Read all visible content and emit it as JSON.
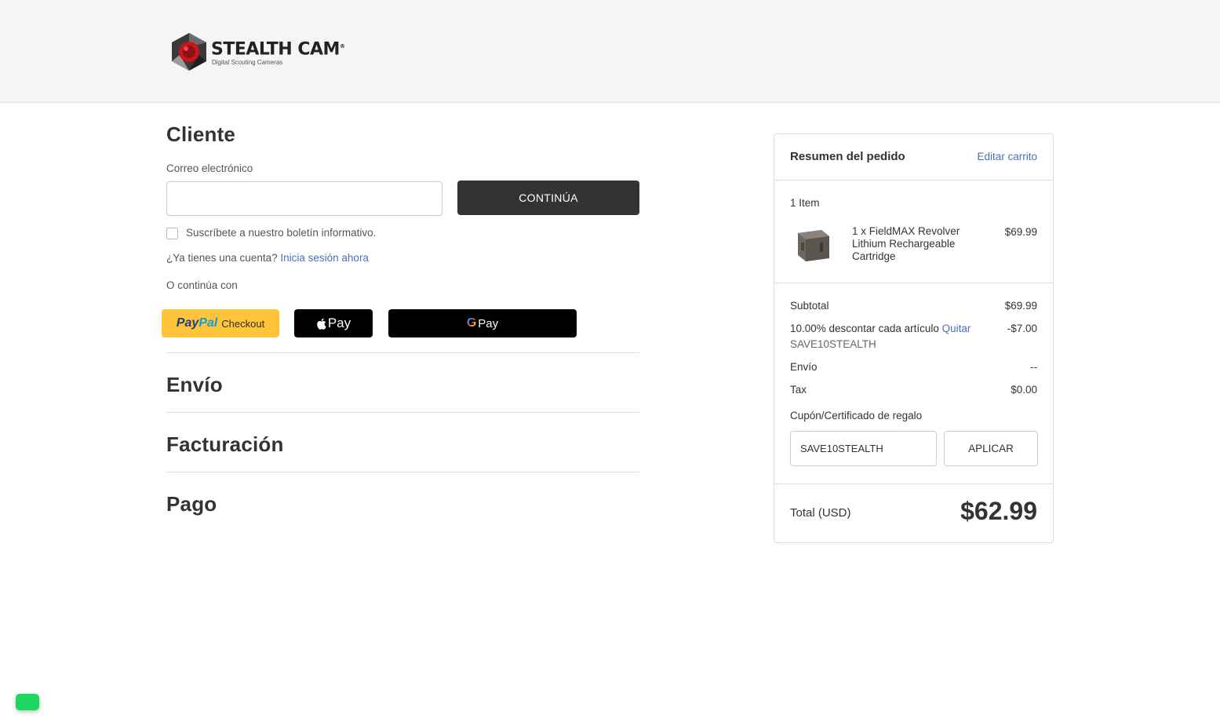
{
  "brand": {
    "name": "STEALTH CAM",
    "trademark": "®",
    "tagline": "Digital Scouting Cameras"
  },
  "customer": {
    "title": "Cliente",
    "email_label": "Correo electrónico",
    "email_value": "",
    "continue_label": "CONTINÚA",
    "newsletter_label": "Suscríbete a nuestro boletín informativo.",
    "newsletter_checked": false,
    "account_prompt": "¿Ya tienes una cuenta?",
    "sign_in_link": "Inicia sesión ahora",
    "alt_checkout_label": "O continúa con",
    "paypal": {
      "pay": "Pay",
      "pal": "Pal",
      "checkout": "Checkout"
    },
    "apple_pay_label": "Pay",
    "google_pay": {
      "g": "G",
      "label": "Pay"
    }
  },
  "steps": {
    "shipping": "Envío",
    "billing": "Facturación",
    "payment": "Pago"
  },
  "summary": {
    "title": "Resumen del pedido",
    "edit_cart": "Editar carrito",
    "item_count": "1 Item",
    "item": {
      "name": "1 x FieldMAX Revolver Lithium Rechargeable Cartridge",
      "price": "$69.99"
    },
    "subtotal_label": "Subtotal",
    "subtotal_value": "$69.99",
    "discount_label": "10.00% descontar cada artículo",
    "discount_remove": "Quitar",
    "discount_value": "-$7.00",
    "discount_code": "SAVE10STEALTH",
    "shipping_label": "Envío",
    "shipping_value": "--",
    "tax_label": "Tax",
    "tax_value": "$0.00",
    "coupon_label": "Cupón/Certificado de regalo",
    "coupon_value": "SAVE10STEALTH",
    "apply_label": "APLICAR",
    "total_label": "Total (USD)",
    "total_value": "$62.99"
  },
  "colors": {
    "link": "#4b71b8",
    "button_dark": "#333333",
    "paypal_yellow": "#ffc439",
    "chat_green": "#1ed760"
  }
}
